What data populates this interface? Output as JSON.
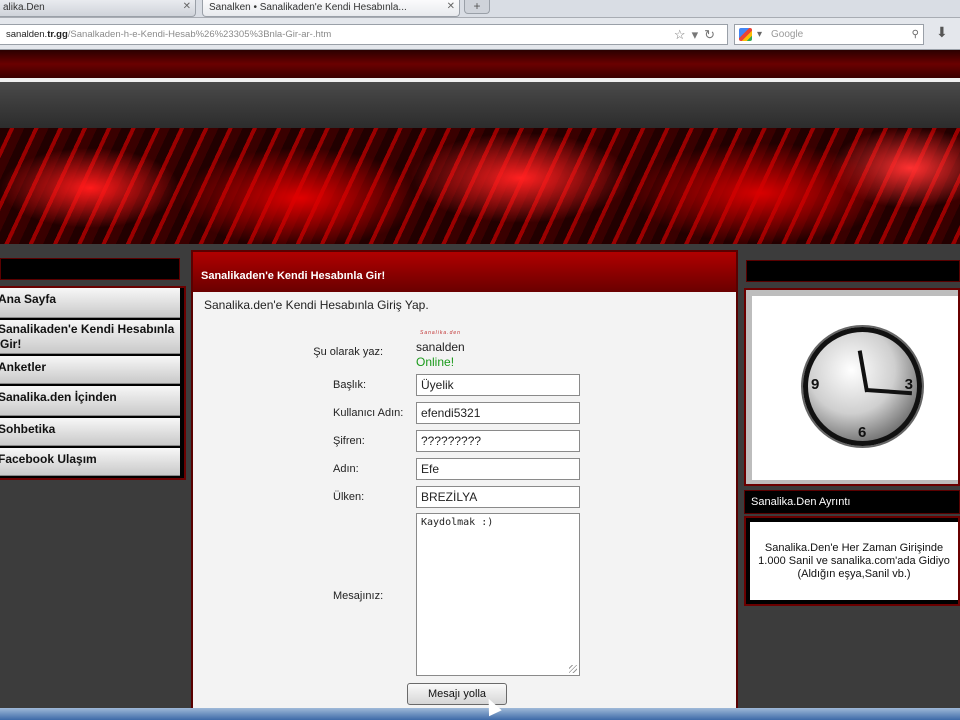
{
  "browser": {
    "tabs": [
      {
        "title": "alika.Den"
      },
      {
        "title": "Sanalken • Sanalikaden'e Kendi Hesabınla..."
      }
    ],
    "url_domain": "sanalden.",
    "url_domain_bold": "tr.gg",
    "url_path": "/Sanalkaden-h-e-Kendi-Hesab%26%23305%3Bnla-Gir-ar-.htm",
    "search_placeholder": "Google"
  },
  "sidebar": {
    "items": [
      {
        "label": "Ana Sayfa"
      },
      {
        "label": "Sanalikaden'e Kendi Hesabınla Gir!"
      },
      {
        "label": "Anketler"
      },
      {
        "label": "Sanalika.den İçinden"
      },
      {
        "label": "Sohbetika"
      },
      {
        "label": "Facebook Ulaşım"
      }
    ]
  },
  "content": {
    "title": "Sanalikaden'e Kendi Hesabınla Gir!",
    "intro": "Sanalika.den'e Kendi Hesabınla Giriş Yap.",
    "form": {
      "as_label": "Şu olarak yaz:",
      "avatar_text": "Sanalika.den",
      "username": "sanalden",
      "status": "Online!",
      "subject_label": "Başlık:",
      "subject_value": "Üyelik",
      "user_label": "Kullanıcı Adın:",
      "user_value": "efendi5321",
      "password_label": "Şifren:",
      "password_value": "?????????",
      "name_label": "Adın:",
      "name_value": "Efe",
      "country_label": "Ülken:",
      "country_value": "BREZİLYA",
      "message_label": "Mesajınız:",
      "message_value": "Kaydolmak :)",
      "send_label": "Mesajı yolla"
    }
  },
  "right": {
    "clock_numbers": [
      "9",
      "3",
      "6"
    ],
    "section_title": "Sanalika.Den Ayrıntı",
    "info_lines": [
      "Sanalika.Den'e Her Zaman Girişinde",
      "1.000 Sanil ve sanalika.com'ada Gidiyo",
      "(Aldığın eşya,Sanil vb.)"
    ]
  }
}
